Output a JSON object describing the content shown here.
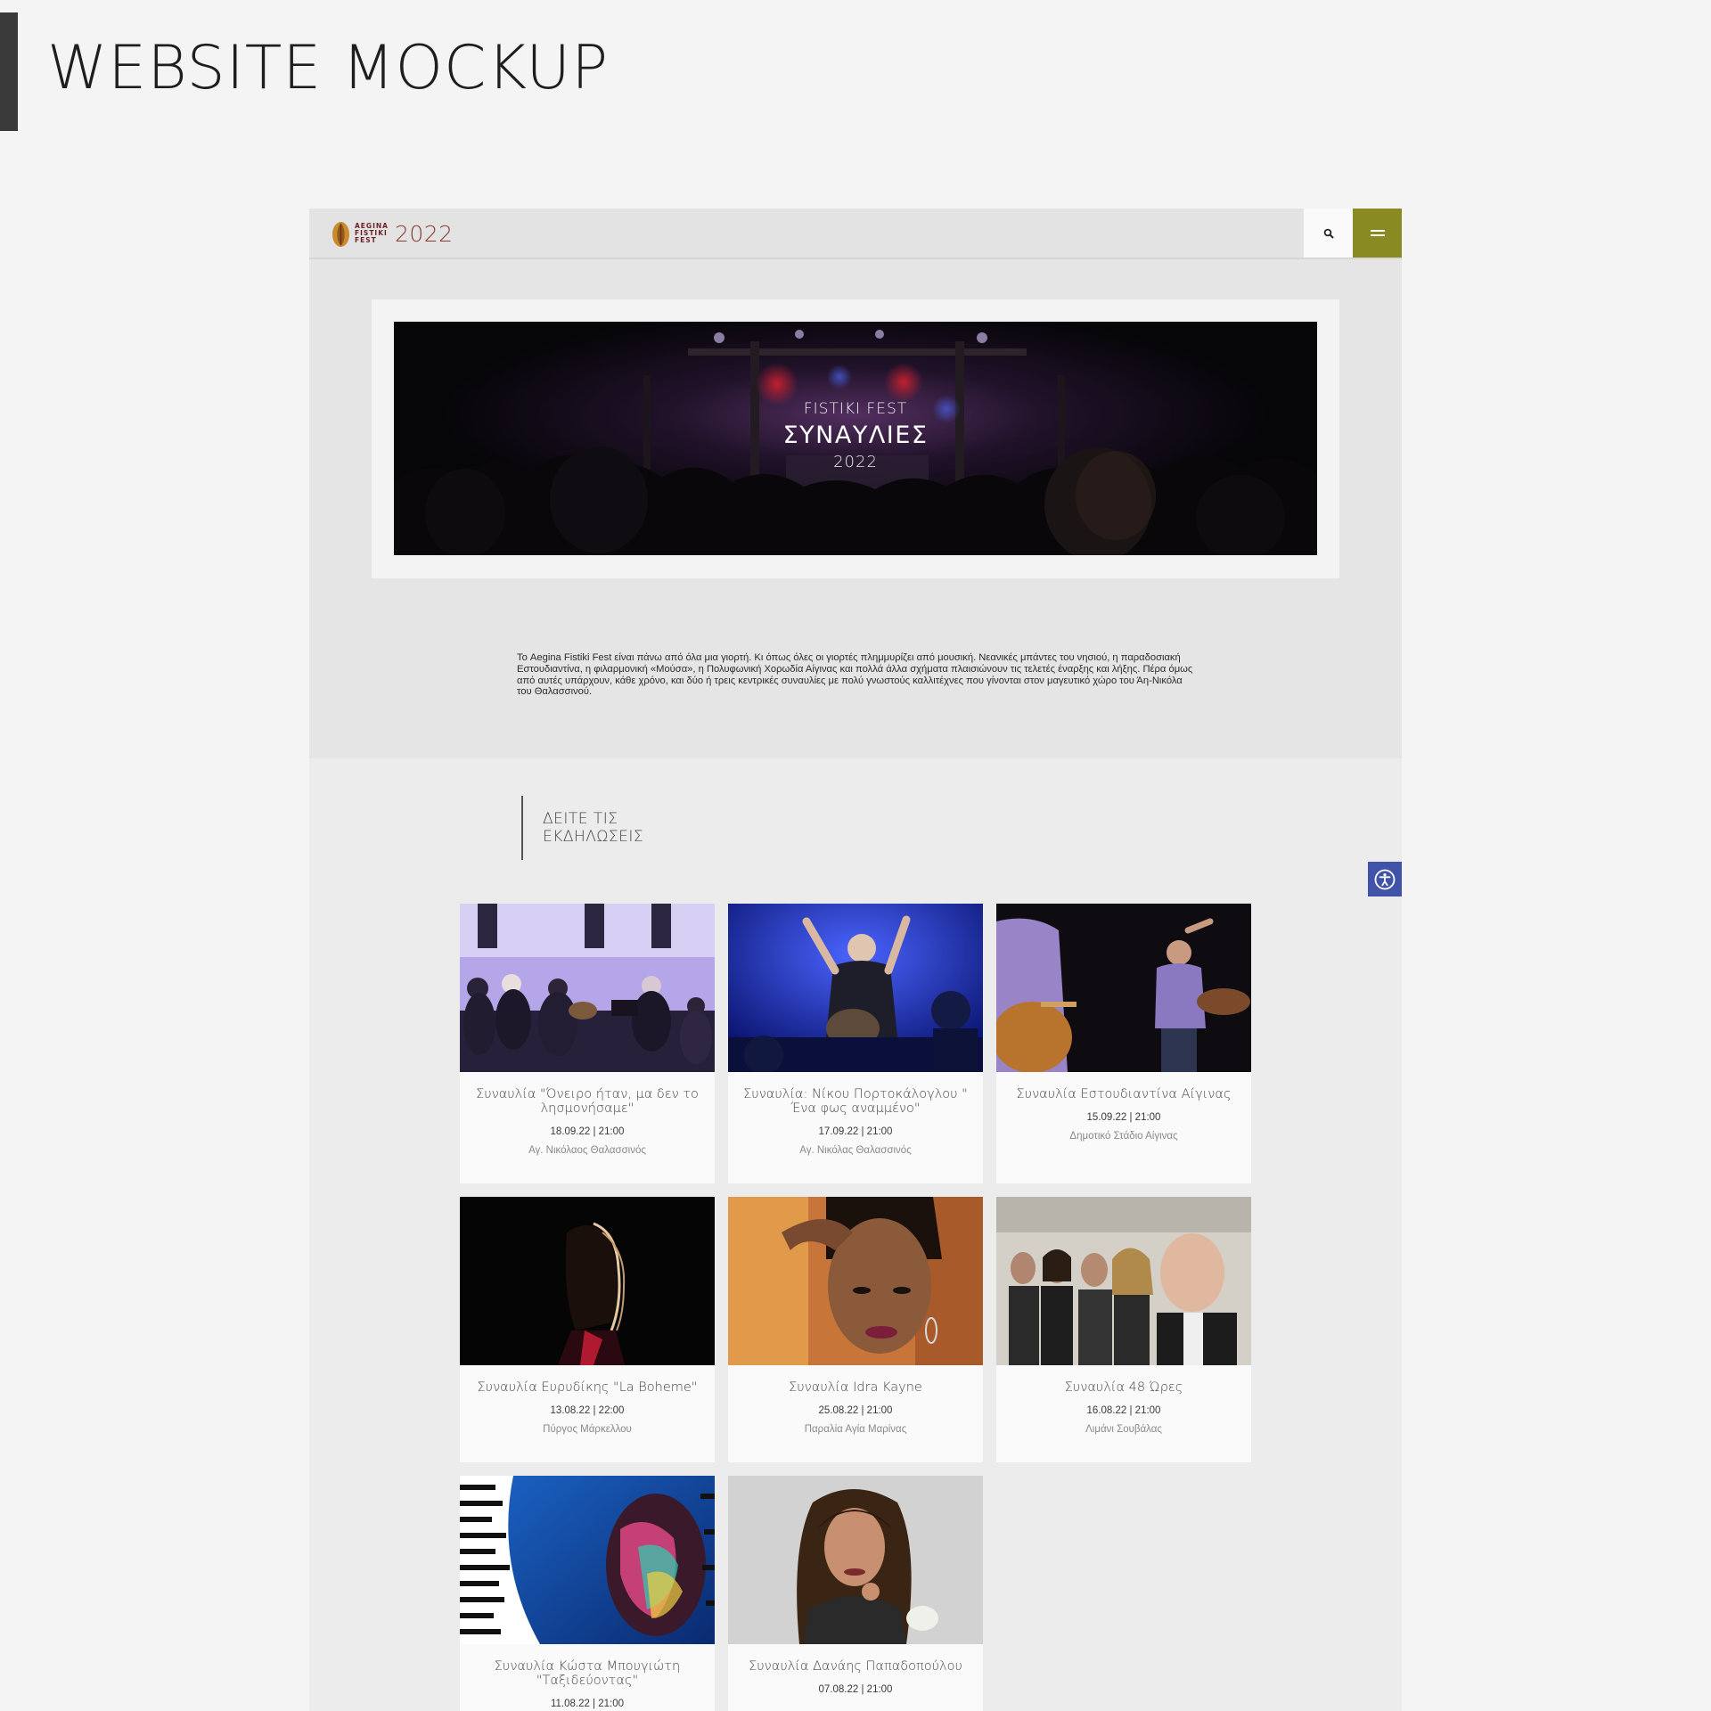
{
  "page": {
    "heading": "WEBSITE MOCKUP"
  },
  "site": {
    "logo": {
      "words": [
        "AEGINA",
        "FISTIKI",
        "FEST"
      ],
      "year": "2022",
      "brand_color": "#6e1f26"
    },
    "header": {
      "search_icon": "search-icon",
      "menu_icon": "hamburger-menu-icon",
      "menu_color": "#8a8a23"
    },
    "hero": {
      "pre": "FISTIKI FEST",
      "main": "ΣΥΝΑΥΛΙΕΣ",
      "year": "2022"
    },
    "intro": "Το Aegina Fistiki Fest είναι πάνω από όλα μια γιορτή. Κι όπως όλες οι γιορτές πλημμυρίζει από μουσική. Νεανικές μπάντες του νησιού, η παραδοσιακή Εστουδιαντίνα, η φιλαρμονική «Μούσα», η Πολυφωνική Χορωδία Αίγινας και πολλά άλλα σχήματα πλαισιώνουν τις τελετές έναρξης και λήξης. Πέρα όμως από αυτές υπάρχουν, κάθε χρόνο, και δύο ή τρεις κεντρικές συναυλίες με πολύ γνωστούς καλλιτέχνες που γίνονται στον μαγευτικό χώρο του Άη-Νικόλα του Θαλασσινού.",
    "section_title": [
      "ΔΕΙΤΕ ΤΙΣ",
      "ΕΚΔΗΛΩΣΕΙΣ"
    ],
    "events": [
      {
        "title": "Συναυλία \"Όνειρο ήταν, μα δεν το λησμονήσαμε\"",
        "date": "18.09.22 | 21:00",
        "location": "Αγ. Νικόλαος Θαλασσινός"
      },
      {
        "title": "Συναυλία: Νίκου Πορτοκάλογλου \" Ένα φως αναμμένο\"",
        "date": "17.09.22 | 21:00",
        "location": "Αγ. Νικόλας Θαλασσινός"
      },
      {
        "title": "Συναυλία Εστουδιαντίνα Αίγινας",
        "date": "15.09.22 | 21:00",
        "location": "Δημοτικό Στάδιο Αίγινας"
      },
      {
        "title": "Συναυλία Ευρυδίκης \"La Boheme\"",
        "date": "13.08.22 | 22:00",
        "location": "Πύργος Μάρκελλου"
      },
      {
        "title": "Συναυλία Idra Kayne",
        "date": "25.08.22 | 21:00",
        "location": "Παραλία Αγία Μαρίνας"
      },
      {
        "title": "Συναυλία 48 Ώρες",
        "date": "16.08.22 | 21:00",
        "location": "Λιμάνι Σουβάλας"
      },
      {
        "title": "Συναυλία Κώστα Μπουγιώτη \"Ταξιδεύοντας\"",
        "date": "11.08.22 | 21:00",
        "location": ""
      },
      {
        "title": "Συναυλία Δανάης Παπαδοπούλου",
        "date": "07.08.22 | 21:00",
        "location": ""
      }
    ],
    "accessibility": {
      "icon": "accessibility-icon",
      "color": "#4153a8"
    }
  }
}
